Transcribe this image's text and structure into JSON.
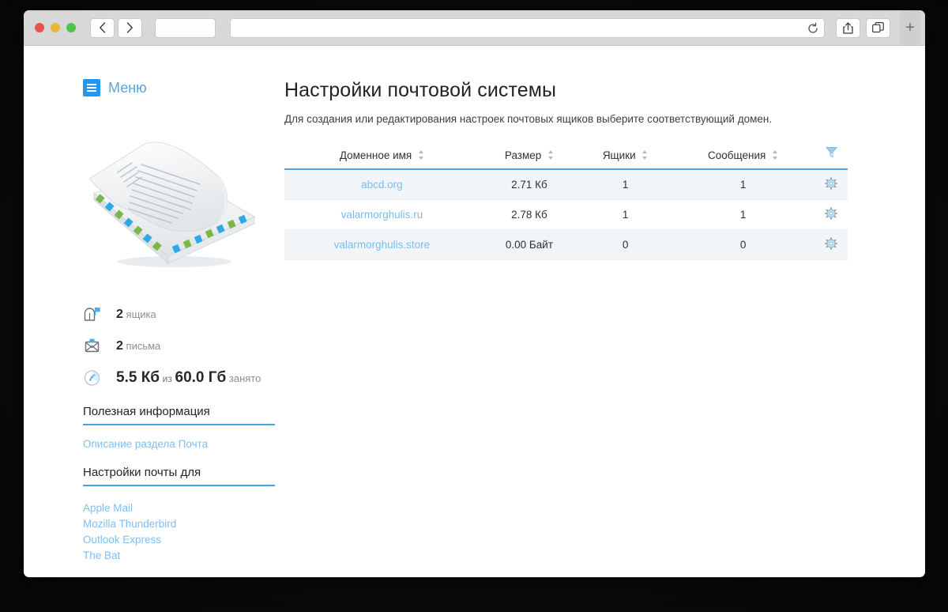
{
  "browser": {
    "traffic_lights": [
      "close",
      "minimize",
      "zoom"
    ],
    "back_label": "‹",
    "forward_label": "›",
    "sidebar_icon": "sidebar-icon",
    "url_value": "",
    "url_placeholder": "",
    "reload_icon": "reload-icon",
    "share_icon": "share-icon",
    "tabs_icon": "tabs-icon",
    "new_tab_label": "+"
  },
  "sidebar": {
    "menu_label": "Меню",
    "menu_icon": "hamburger-icon",
    "illustration_alt": "envelope-letter-illustration",
    "stats": [
      {
        "icon": "mailbox-icon",
        "value": "2",
        "unit": "ящика"
      },
      {
        "icon": "envelope-icon",
        "value": "2",
        "unit": "письма"
      },
      {
        "icon": "disk-icon",
        "value": "5.5 Кб",
        "middle": "из",
        "value2": "60.0 Гб",
        "unit": "занято"
      }
    ],
    "info_heading": "Полезная информация",
    "info_link": "Описание раздела Почта",
    "clients_heading": "Настройки почты для",
    "clients": [
      "Apple Mail",
      "Mozilla Thunderbird",
      "Outlook Express",
      "The Bat"
    ]
  },
  "main": {
    "title": "Настройки почтовой системы",
    "subtitle": "Для создания или редактирования настроек почтовых ящиков выберите соответствующий домен.",
    "table": {
      "columns": [
        "Доменное имя",
        "Размер",
        "Ящики",
        "Сообщения"
      ],
      "filter_icon": "filter-funnel-icon",
      "row_action_icon": "gear-icon",
      "rows": [
        {
          "domain": "abcd.org",
          "size": "2.71 Кб",
          "mailboxes": "1",
          "messages": "1"
        },
        {
          "domain": "valarmorghulis.ru",
          "size": "2.78 Кб",
          "mailboxes": "1",
          "messages": "1"
        },
        {
          "domain": "valarmorghulis.store",
          "size": "0.00 Байт",
          "mailboxes": "0",
          "messages": "0"
        }
      ]
    }
  },
  "colors": {
    "accent_blue": "#46a5e0",
    "link_blue": "#77bdf0",
    "menu_blue": "#2196f3",
    "row_alt": "#f2f5f7",
    "text_dark": "#2b3035"
  }
}
